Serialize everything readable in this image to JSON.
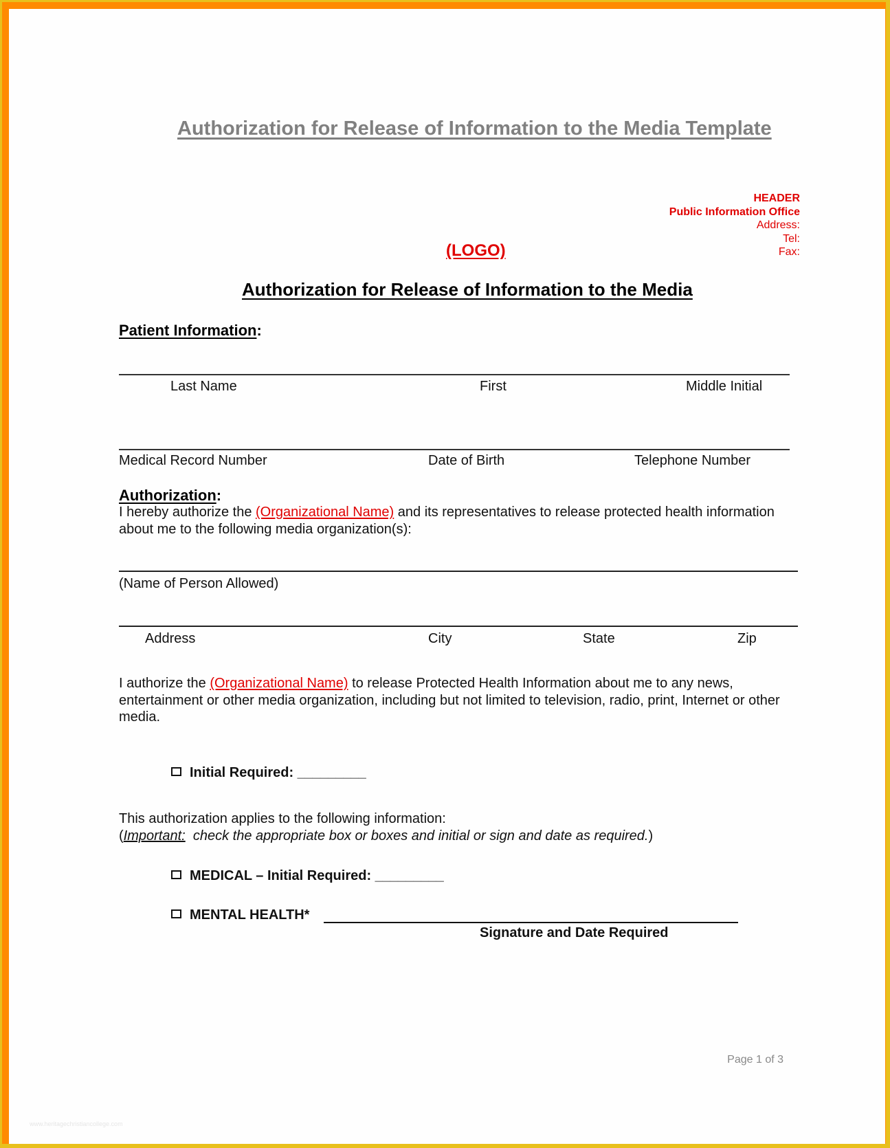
{
  "document": {
    "top_title": "Authorization for Release of Information to the Media Template",
    "header": {
      "label": "HEADER",
      "office": "Public Information Office",
      "address": "Address:",
      "tel": "Tel:",
      "fax": "Fax:"
    },
    "logo": "(LOGO)",
    "form_title": "Authorization for Release of Information to the Media",
    "patient_section": {
      "heading": "Patient Information",
      "colon": ":",
      "row1_labels": [
        "Last Name",
        "First",
        "Middle Initial"
      ],
      "row2_labels": [
        "Medical Record Number",
        "Date of Birth",
        "Telephone Number"
      ]
    },
    "authorization_section": {
      "heading": "Authorization",
      "colon": ":",
      "para1_start": "I hereby authorize the ",
      "org_name": "(Organizational Name)",
      "para1_end": " and its representatives to release protected health information about me to the following media organization(s):",
      "person_label": "(Name of Person Allowed)",
      "address_labels": [
        "Address",
        "City",
        "State",
        "Zip"
      ],
      "para2_start": "I authorize the ",
      "para2_end": " to release Protected Health Information about me to any news, entertainment or other media organization, including but not limited to television, radio, print, Internet or other media.",
      "initial_required": "Initial Required: _________",
      "applies_text": "This authorization applies to the following information:",
      "important_open": "(",
      "important_label": "Important:",
      "important_text": "  check the appropriate box or boxes and initial or sign and date as required.",
      "important_close": ")",
      "medical_item": "MEDICAL – Initial Required: _________",
      "mental_item": "MENTAL HEALTH* ",
      "signature_label": "Signature and Date Required"
    },
    "footer": {
      "page": "Page 1 of 3"
    },
    "watermark": "www.heritagechristiancollege.com"
  }
}
